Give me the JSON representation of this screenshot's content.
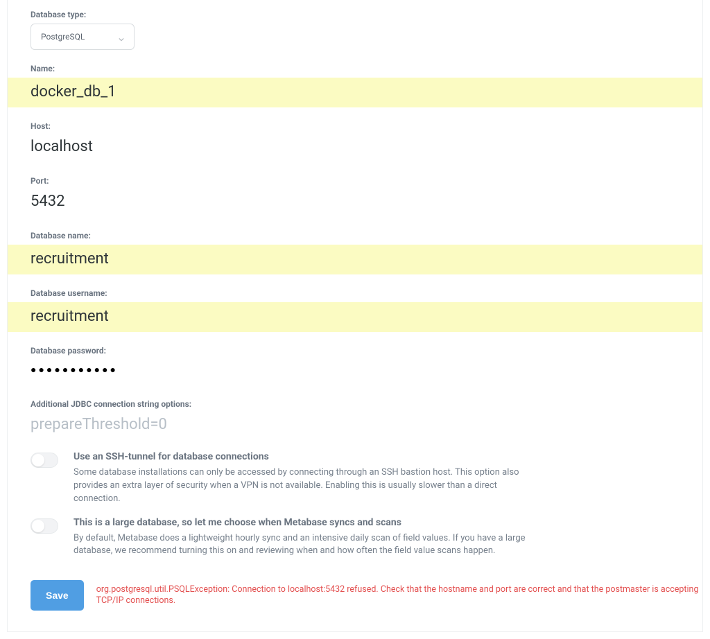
{
  "fields": {
    "database_type": {
      "label": "Database type:",
      "value": "PostgreSQL"
    },
    "name": {
      "label": "Name:",
      "value": "docker_db_1"
    },
    "host": {
      "label": "Host:",
      "value": "localhost"
    },
    "port": {
      "label": "Port:",
      "value": "5432"
    },
    "database_name": {
      "label": "Database name:",
      "value": "recruitment"
    },
    "database_user": {
      "label": "Database username:",
      "value": "recruitment"
    },
    "database_pass": {
      "label": "Database password:",
      "value": "●●●●●●●●●●●"
    },
    "jdbc": {
      "label": "Additional JDBC connection string options:",
      "placeholder": "prepareThreshold=0"
    }
  },
  "toggles": {
    "ssh": {
      "title": "Use an SSH-tunnel for database connections",
      "desc": "Some database installations can only be accessed by connecting through an SSH bastion host. This option also provides an extra layer of security when a VPN is not available. Enabling this is usually slower than a direct connection."
    },
    "large": {
      "title": "This is a large database, so let me choose when Metabase syncs and scans",
      "desc": "By default, Metabase does a lightweight hourly sync and an intensive daily scan of field values. If you have a large database, we recommend turning this on and reviewing when and how often the field value scans happen."
    }
  },
  "footer": {
    "save_label": "Save",
    "error": "org.postgresql.util.PSQLException: Connection to localhost:5432 refused. Check that the hostname and port are correct and that the postmaster is accepting TCP/IP connections."
  }
}
